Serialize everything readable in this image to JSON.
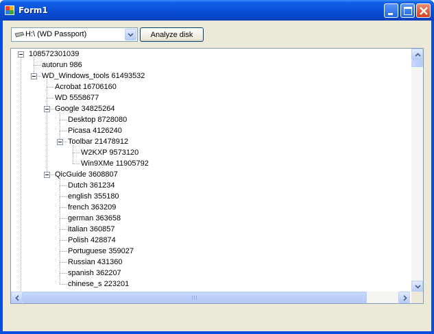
{
  "window": {
    "title": "Form1",
    "accent_color": "#0a50d8",
    "icons": {
      "app": "form-app-icon",
      "minimize": "minimize-icon",
      "maximize": "maximize-icon",
      "close": "close-icon"
    }
  },
  "toolbar": {
    "drive_select": {
      "value": "H:\\ (WD Passport)",
      "icon": "drive-icon"
    },
    "analyze_label": "Analyze disk"
  },
  "tree": {
    "nodes": [
      {
        "label": "108572301039",
        "depth": 0,
        "expanded": true
      },
      {
        "label": "autorun 986",
        "depth": 1
      },
      {
        "label": "WD_Windows_tools 61493532",
        "depth": 1,
        "expanded": true
      },
      {
        "label": "Acrobat 16706160",
        "depth": 2
      },
      {
        "label": "WD 5558677",
        "depth": 2
      },
      {
        "label": "Google 34825264",
        "depth": 2,
        "expanded": true
      },
      {
        "label": "Desktop 8728080",
        "depth": 3
      },
      {
        "label": "Picasa 4126240",
        "depth": 3
      },
      {
        "label": "Toolbar 21478912",
        "depth": 3,
        "expanded": true
      },
      {
        "label": "W2KXP 9573120",
        "depth": 4
      },
      {
        "label": "Win9XMe 11905792",
        "depth": 4
      },
      {
        "label": "QicGuide 3608807",
        "depth": 2,
        "expanded": true
      },
      {
        "label": "Dutch 361234",
        "depth": 3
      },
      {
        "label": "english 355180",
        "depth": 3
      },
      {
        "label": "french 363209",
        "depth": 3
      },
      {
        "label": "german 363658",
        "depth": 3
      },
      {
        "label": "italian 360857",
        "depth": 3
      },
      {
        "label": "Polish 428874",
        "depth": 3
      },
      {
        "label": "Portuguese 359027",
        "depth": 3
      },
      {
        "label": "Russian 431360",
        "depth": 3
      },
      {
        "label": "spanish 362207",
        "depth": 3
      },
      {
        "label": "chinese_s 223201",
        "depth": 3
      }
    ]
  },
  "scrollbars": {
    "vertical": {
      "up_icon": "scroll-up-icon",
      "down_icon": "scroll-down-icon",
      "position": 0.0
    },
    "horizontal": {
      "left_icon": "scroll-left-icon",
      "right_icon": "scroll-right-icon",
      "position": 0.0
    }
  }
}
